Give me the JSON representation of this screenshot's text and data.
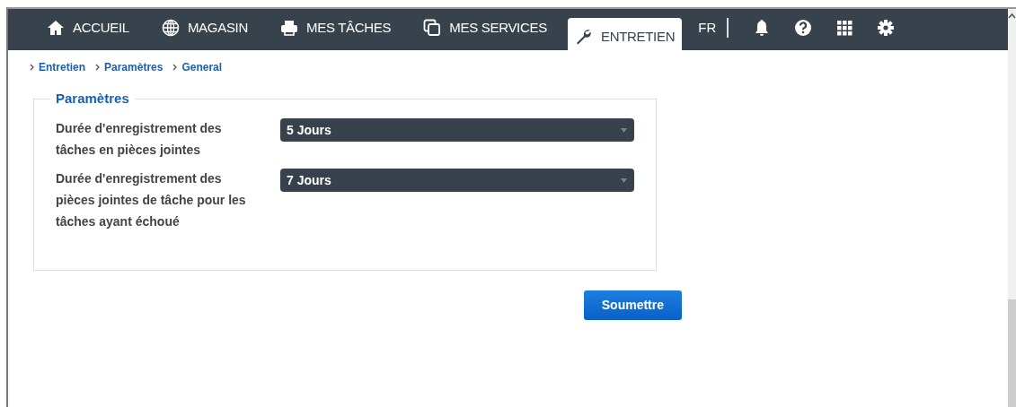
{
  "nav": {
    "tabs": [
      {
        "label": "ACCUEIL",
        "selected": false
      },
      {
        "label": "MAGASIN",
        "selected": false
      },
      {
        "label": "MES TÂCHES",
        "selected": false
      },
      {
        "label": "MES SERVICES",
        "selected": false
      },
      {
        "label": "ENTRETIEN",
        "selected": true
      }
    ],
    "language": "FR"
  },
  "breadcrumb": [
    "Entretien",
    "Paramètres",
    "General"
  ],
  "settings": {
    "legend": "Paramètres",
    "fields": [
      {
        "label": "Durée d'enregistrement des tâches en pièces jointes",
        "value": "5 Jours"
      },
      {
        "label": "Durée d'enregistrement des pièces jointes de tâche pour les tâches ayant échoué",
        "value": "7 Jours"
      }
    ]
  },
  "submit_button": "Soumettre"
}
